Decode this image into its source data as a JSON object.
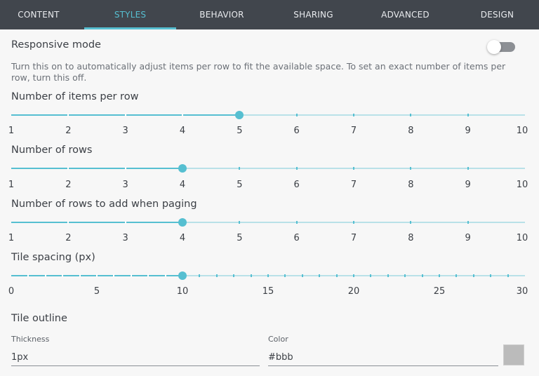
{
  "tabs": [
    {
      "label": "CONTENT",
      "active": false
    },
    {
      "label": "STYLES",
      "active": true
    },
    {
      "label": "BEHAVIOR",
      "active": false
    },
    {
      "label": "SHARING",
      "active": false
    },
    {
      "label": "ADVANCED",
      "active": false
    },
    {
      "label": "DESIGN",
      "active": false
    }
  ],
  "responsive": {
    "title": "Responsive mode",
    "enabled": false,
    "description": "Turn this on to automatically adjust items per row to fit the available space. To set an exact number of items per row, turn this off."
  },
  "sliders": {
    "items_per_row": {
      "label": "Number of items per row",
      "min": 1,
      "max": 10,
      "value": 5,
      "tick_labels": [
        "1",
        "2",
        "3",
        "4",
        "5",
        "6",
        "7",
        "8",
        "9",
        "10"
      ]
    },
    "rows": {
      "label": "Number of rows",
      "min": 1,
      "max": 10,
      "value": 4,
      "tick_labels": [
        "1",
        "2",
        "3",
        "4",
        "5",
        "6",
        "7",
        "8",
        "9",
        "10"
      ]
    },
    "rows_paging": {
      "label": "Number of rows to add when paging",
      "min": 1,
      "max": 10,
      "value": 4,
      "tick_labels": [
        "1",
        "2",
        "3",
        "4",
        "5",
        "6",
        "7",
        "8",
        "9",
        "10"
      ]
    },
    "tile_spacing": {
      "label": "Tile spacing (px)",
      "min": 0,
      "max": 30,
      "value": 10,
      "tick_labels": [
        "0",
        "5",
        "10",
        "15",
        "20",
        "25",
        "30"
      ]
    }
  },
  "outline": {
    "title": "Tile outline",
    "thickness_label": "Thickness",
    "thickness_value": "1px",
    "color_label": "Color",
    "color_value": "#bbb"
  },
  "colors": {
    "accent": "#56bfd1",
    "tabbar": "#41464d",
    "swatch": "#bbbbbb"
  }
}
